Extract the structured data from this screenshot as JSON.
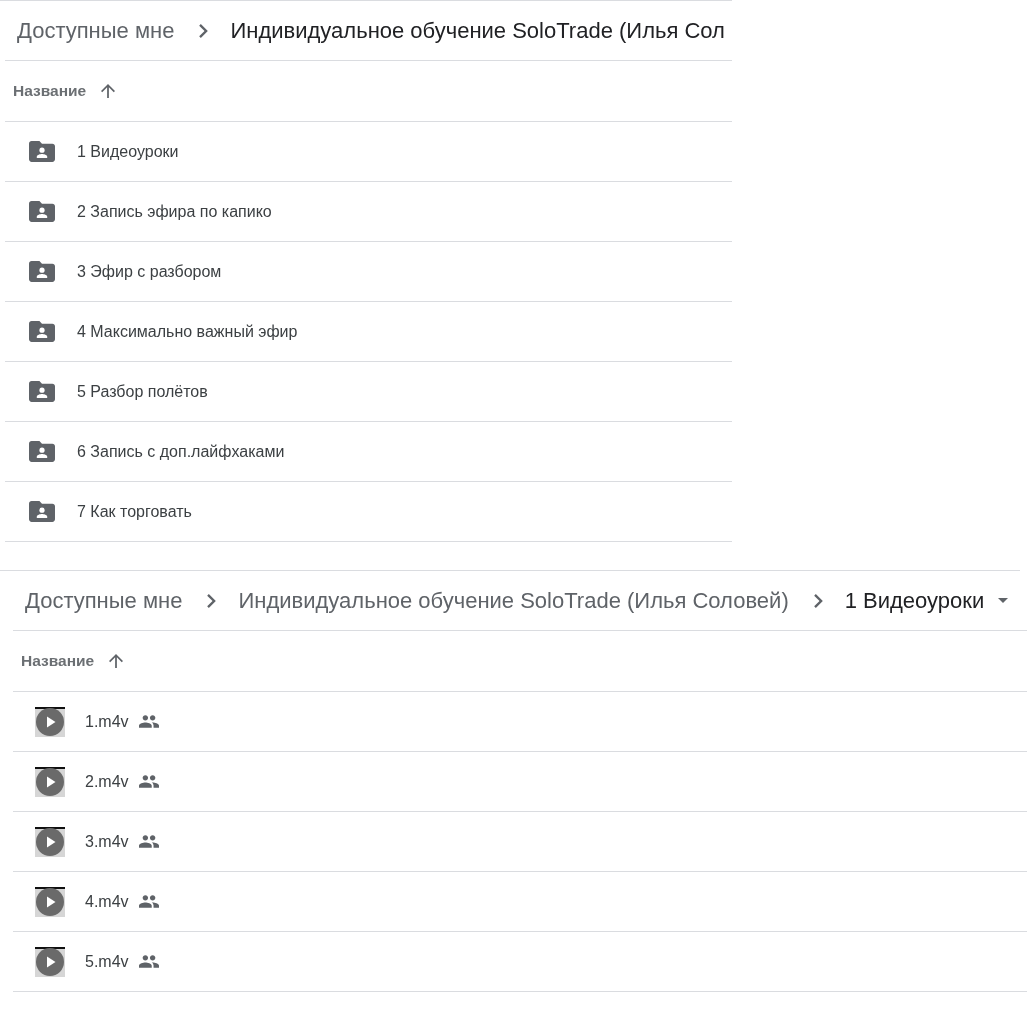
{
  "panels": [
    {
      "breadcrumb": [
        {
          "label": "Доступные мне",
          "current": false,
          "dropdown": false
        },
        {
          "label": "Индивидуальное обучение SoloTrade (Илья Сол",
          "current": true,
          "dropdown": false
        }
      ],
      "column_header": {
        "label": "Название",
        "ascending": true
      },
      "rows": [
        {
          "kind": "shared_folder",
          "name": "1 Видеоуроки",
          "shared_badge": false
        },
        {
          "kind": "shared_folder",
          "name": "2 Запись эфира по капико",
          "shared_badge": false
        },
        {
          "kind": "shared_folder",
          "name": "3 Эфир с разбором",
          "shared_badge": false
        },
        {
          "kind": "shared_folder",
          "name": "4 Максимально важный эфир",
          "shared_badge": false
        },
        {
          "kind": "shared_folder",
          "name": "5 Разбор полётов",
          "shared_badge": false
        },
        {
          "kind": "shared_folder",
          "name": "6 Запись с доп.лайфхаками",
          "shared_badge": false
        },
        {
          "kind": "shared_folder",
          "name": "7 Как торговать",
          "shared_badge": false
        }
      ]
    },
    {
      "breadcrumb": [
        {
          "label": "Доступные мне",
          "current": false,
          "dropdown": false
        },
        {
          "label": "Индивидуальное обучение SoloTrade (Илья Соловей)",
          "current": false,
          "dropdown": false
        },
        {
          "label": "1 Видеоуроки",
          "current": true,
          "dropdown": true
        }
      ],
      "column_header": {
        "label": "Название",
        "ascending": true
      },
      "rows": [
        {
          "kind": "video",
          "name": "1.m4v",
          "shared_badge": true
        },
        {
          "kind": "video",
          "name": "2.m4v",
          "shared_badge": true
        },
        {
          "kind": "video",
          "name": "3.m4v",
          "shared_badge": true
        },
        {
          "kind": "video",
          "name": "4.m4v",
          "shared_badge": true
        },
        {
          "kind": "video",
          "name": "5.m4v",
          "shared_badge": true
        }
      ]
    }
  ]
}
